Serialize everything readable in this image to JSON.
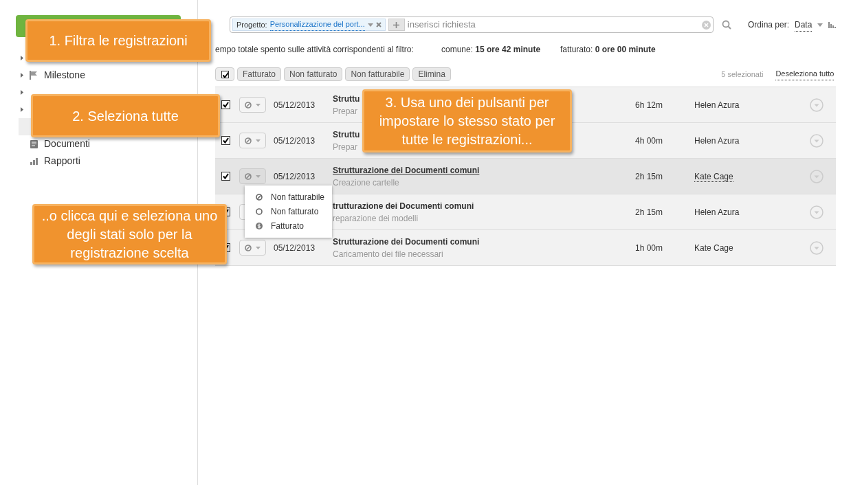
{
  "sidebar": {
    "items": [
      {
        "kind": "hidden",
        "expandable": true,
        "selected": false
      },
      {
        "label": "Milestone",
        "kind": "flag",
        "expandable": true,
        "selected": false
      },
      {
        "kind": "hidden",
        "expandable": true,
        "selected": false
      },
      {
        "kind": "hidden",
        "expandable": true,
        "selected": false
      },
      {
        "kind": "hidden",
        "expandable": false,
        "selected": true
      },
      {
        "label": "Documenti",
        "kind": "doc",
        "expandable": false,
        "selected": false
      },
      {
        "label": "Rapporti",
        "kind": "chart",
        "expandable": false,
        "selected": false
      }
    ]
  },
  "filter": {
    "chip_label": "Progetto:",
    "chip_value": "Personalizzazione del port...",
    "placeholder": "inserisci richiesta"
  },
  "sort": {
    "label": "Ordina per:",
    "value": "Data"
  },
  "totals": {
    "label": "empo totale spento sulle attività corrispondenti al filtro:",
    "common_label": "comune:",
    "common_value": "15 ore 42 minute",
    "billed_label": "fatturato:",
    "billed_value": "0 ore 00 minute"
  },
  "toolbar": {
    "select_all": true,
    "buttons": [
      "Fatturato",
      "Non fatturato",
      "Non fatturabile",
      "Elimina"
    ],
    "selected_count": "5 selezionati",
    "deselect": "Deseleziona tutto"
  },
  "rows": [
    {
      "checked": true,
      "date": "05/12/2013",
      "title": "Struttu",
      "subtitle": "Prepar",
      "duration": "6h 12m",
      "person": "Helen Azura",
      "selected": false
    },
    {
      "checked": true,
      "date": "05/12/2013",
      "title": "Struttu",
      "subtitle": "Prepar",
      "duration": "4h 00m",
      "person": "Helen Azura",
      "selected": false
    },
    {
      "checked": true,
      "date": "05/12/2013",
      "title": "Strutturazione dei Documenti comuni",
      "subtitle": "Creazione cartelle",
      "duration": "2h 15m",
      "person": "Kate Cage",
      "selected": true
    },
    {
      "checked": true,
      "title": "trutturazione dei Documenti comuni",
      "subtitle": "reparazione dei modelli",
      "duration": "2h 15m",
      "person": "Helen Azura",
      "selected": false
    },
    {
      "checked": true,
      "date": "05/12/2013",
      "title": "Strutturazione dei Documenti comuni",
      "subtitle": "Caricamento dei file necessari",
      "duration": "1h 00m",
      "person": "Kate Cage",
      "selected": false
    }
  ],
  "status_menu": [
    {
      "label": "Non fatturabile",
      "kind": "blocked"
    },
    {
      "label": "Non fatturato",
      "kind": "open"
    },
    {
      "label": "Fatturato",
      "kind": "paid"
    }
  ],
  "callouts": [
    "1. Filtra le registrazioni",
    "2. Seleziona tutte",
    "3. Usa uno dei pulsanti per impostare lo stesso stato per tutte le registrazioni...",
    "..o clicca qui e seleziona uno degli stati solo per la registrazione scelta"
  ]
}
